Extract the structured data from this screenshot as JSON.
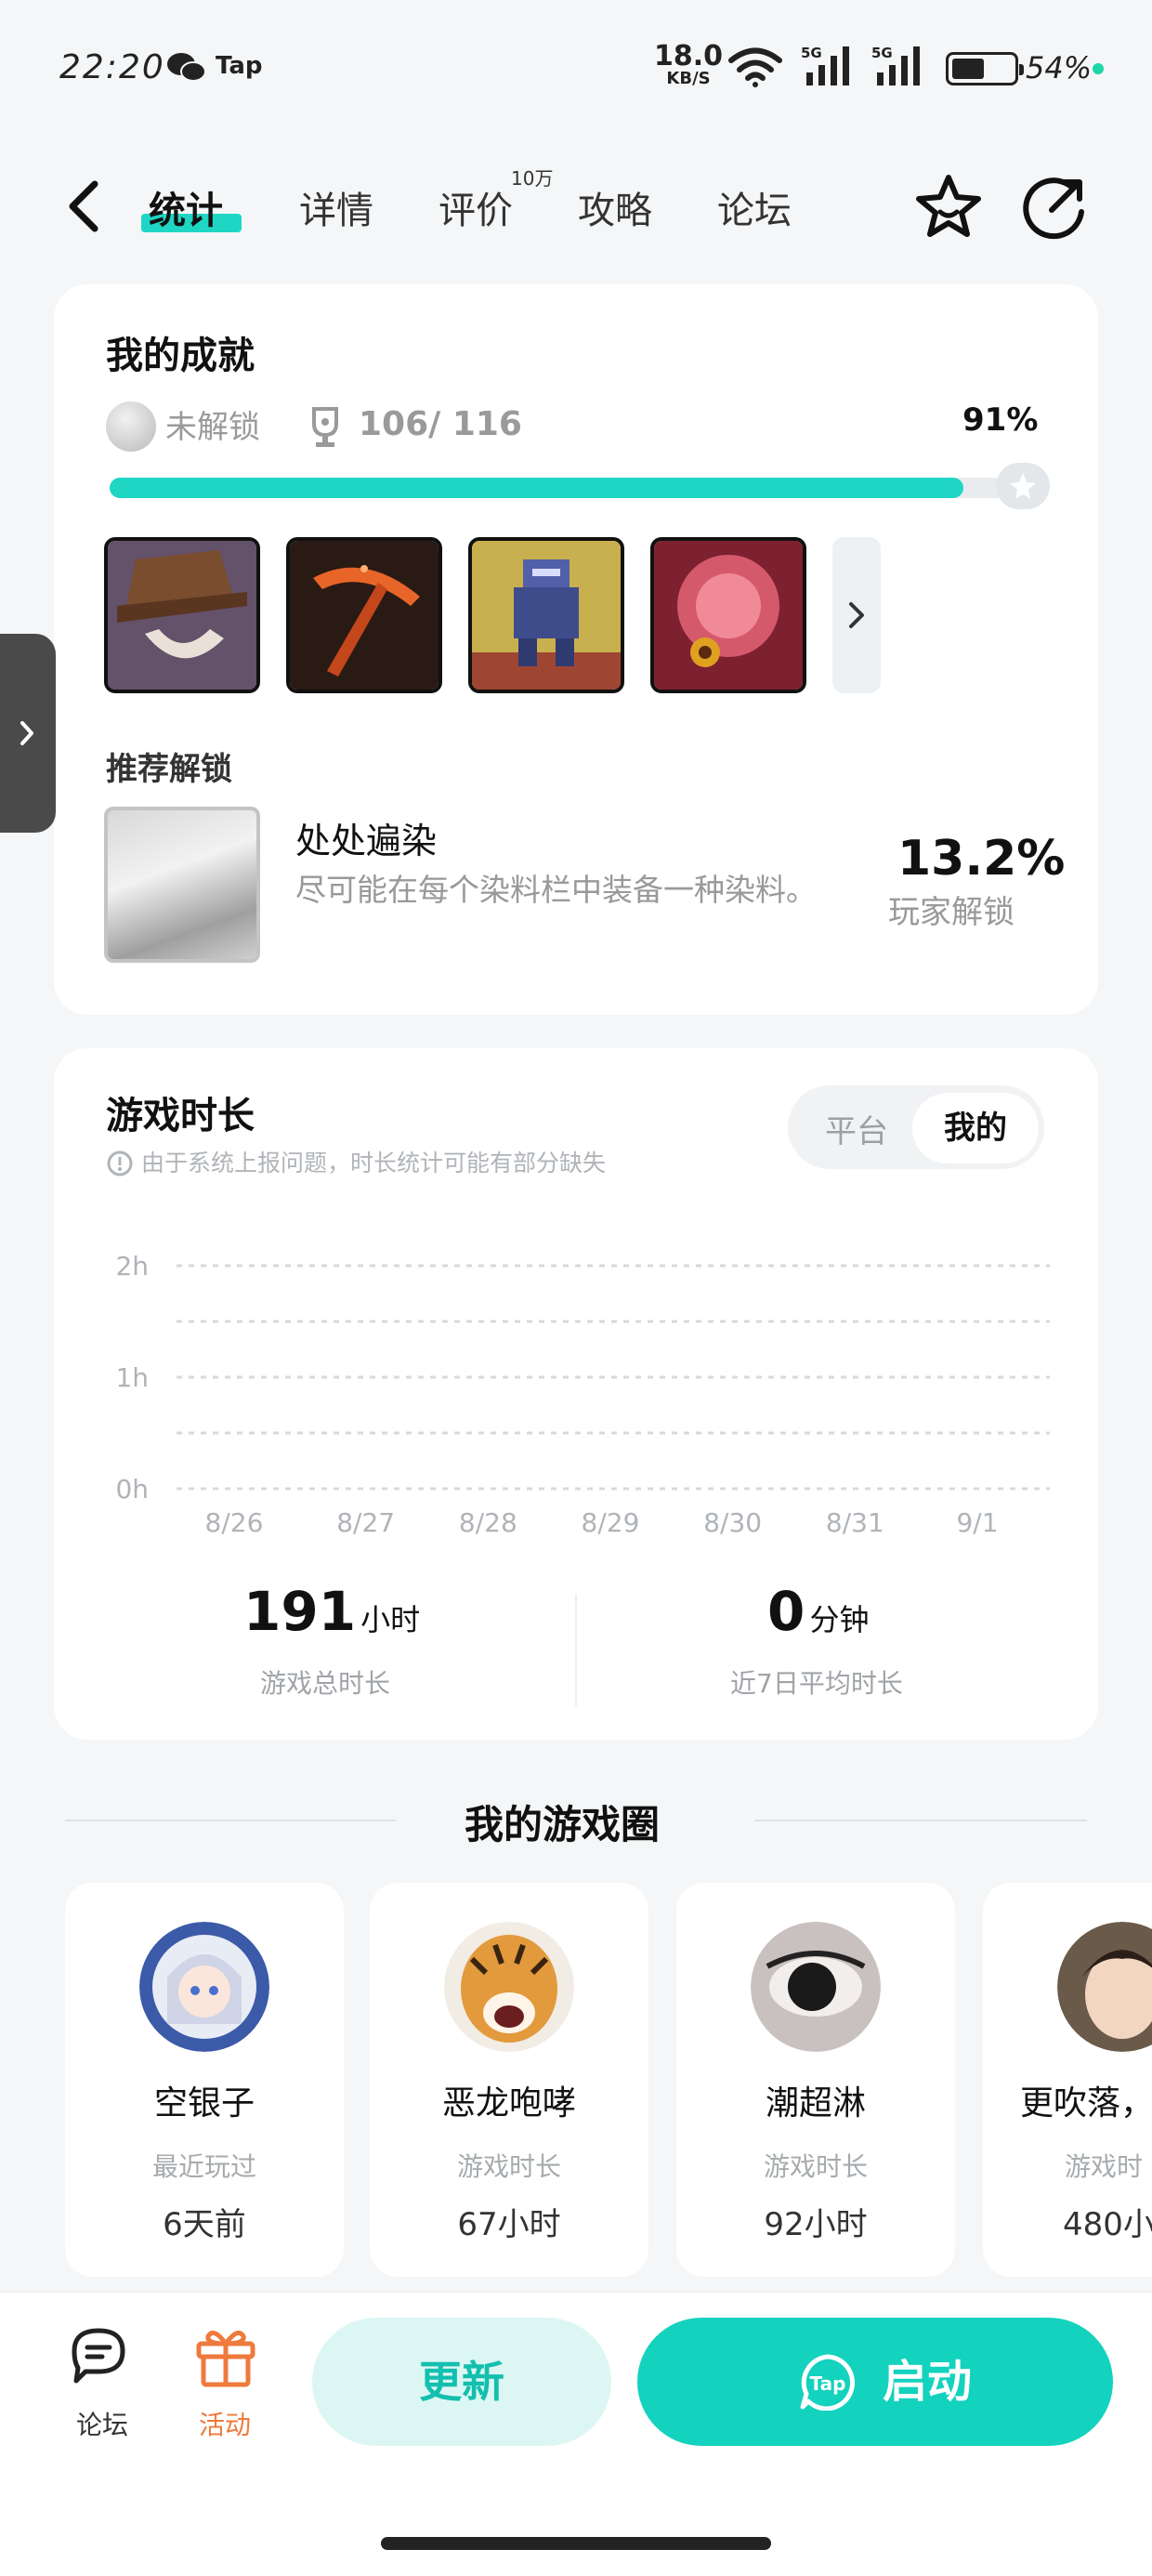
{
  "status_bar": {
    "time": "22:20",
    "app_label": "Tap",
    "net_speed": "18.0",
    "net_unit": "KB/S",
    "sig1_label": "5G",
    "sig2_label": "5G",
    "battery": "54%"
  },
  "nav": {
    "tabs": [
      "统计",
      "详情",
      "评价",
      "攻略",
      "论坛"
    ],
    "active_tab": 0,
    "review_badge": "10万"
  },
  "achievements": {
    "title": "我的成就",
    "locked_label": "未解锁",
    "count": "106/ 116",
    "percent": "91%",
    "progress": 0.91,
    "recommend_title": "推荐解锁",
    "recommend": {
      "name": "处处遍染",
      "description": "尽可能在每个染料栏中装备一种染料。",
      "rate": "13.2%",
      "rate_label": "玩家解锁"
    }
  },
  "playtime": {
    "title": "游戏时长",
    "note": "由于系统上报问题，时长统计可能有部分缺失",
    "toggle": {
      "platform": "平台",
      "mine": "我的",
      "selected": "mine"
    },
    "total_value": "191",
    "total_unit": "小时",
    "total_label": "游戏总时长",
    "avg_value": "0",
    "avg_unit": "分钟",
    "avg_label": "近7日平均时长"
  },
  "chart_data": {
    "type": "bar",
    "categories": [
      "8/26",
      "8/27",
      "8/28",
      "8/29",
      "8/30",
      "8/31",
      "9/1"
    ],
    "values": [
      0,
      0,
      0,
      0,
      0,
      0,
      0
    ],
    "y_ticks": [
      "2h",
      "1h",
      "0h"
    ],
    "ylim": [
      0,
      2
    ],
    "grid": true
  },
  "circle": {
    "title": "我的游戏圈",
    "players": [
      {
        "name": "空银子",
        "label": "最近玩过",
        "value": "6天前"
      },
      {
        "name": "恶龙咆哮",
        "label": "游戏时长",
        "value": "67小时"
      },
      {
        "name": "潮超淋",
        "label": "游戏时长",
        "value": "92小时"
      },
      {
        "name": "更吹落，",
        "label": "游戏时",
        "value": "480小"
      }
    ]
  },
  "bottom_bar": {
    "forum_label": "论坛",
    "activity_label": "活动",
    "update_label": "更新",
    "start_label": "启动",
    "accent": "#13d2be",
    "activity_color": "#ee7a3c"
  }
}
